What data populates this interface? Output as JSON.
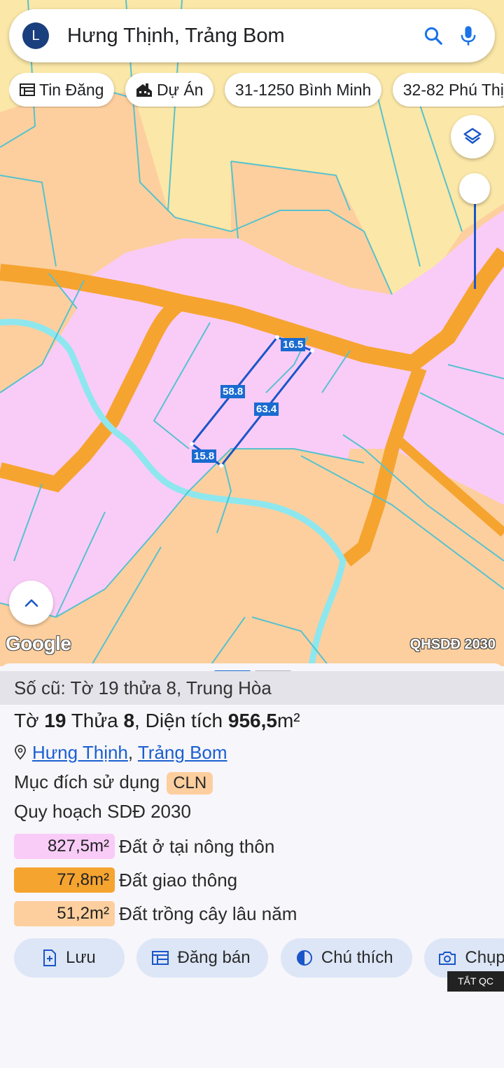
{
  "search": {
    "avatar_letter": "L",
    "query": "Hưng Thịnh, Trảng Bom"
  },
  "chips": [
    {
      "label": "Tin Đăng",
      "icon": "listing-icon"
    },
    {
      "label": "Dự Án",
      "icon": "building-icon"
    },
    {
      "label": "31-1250 Bình Minh",
      "icon": ""
    },
    {
      "label": "32-82 Phú Thị",
      "icon": ""
    }
  ],
  "map": {
    "brand": "Google",
    "layer_label": "QHSDĐ 2030",
    "measurements": [
      "16.5",
      "58.8",
      "63.4",
      "15.8"
    ],
    "colors": {
      "residential": "#f9ccf7",
      "perennial": "#fdcf9e",
      "annual": "#fbe7a7",
      "road": "#f6a430",
      "water": "#8ee7ee",
      "boundary": "#56c2cf",
      "measure": "#1a6bd0"
    }
  },
  "sheet": {
    "old_parcel": "Số cũ: Tờ 19 thửa 8, Trung Hòa",
    "title": {
      "sheet_label": "Tờ",
      "sheet_no": "19",
      "plot_label": "Thửa",
      "plot_no": "8",
      "area_label": ", Diện tích",
      "area_value": "956,5",
      "area_unit": "m²"
    },
    "location": {
      "commune": "Hưng Thịnh",
      "separator": ", ",
      "district": "Trảng Bom"
    },
    "usage_label": "Mục đích sử dụng",
    "usage_code": "CLN",
    "plan_label": "Quy hoạch SDĐ 2030",
    "areas": [
      {
        "value": "827,5m²",
        "label": "Đất ở tại nông thôn",
        "color": "#f9ccf7"
      },
      {
        "value": "77,8m²",
        "label": "Đất giao thông",
        "color": "#f6a430"
      },
      {
        "value": "51,2m²",
        "label": "Đất trồng cây lâu năm",
        "color": "#fdcf9e"
      }
    ],
    "actions": [
      {
        "label": "Lưu",
        "icon": "save-icon"
      },
      {
        "label": "Đăng bán",
        "icon": "post-icon"
      },
      {
        "label": "Chú thích",
        "icon": "legend-icon"
      },
      {
        "label": "Chụp",
        "icon": "camera-icon"
      }
    ],
    "ad_tag": "TẮT QC"
  }
}
